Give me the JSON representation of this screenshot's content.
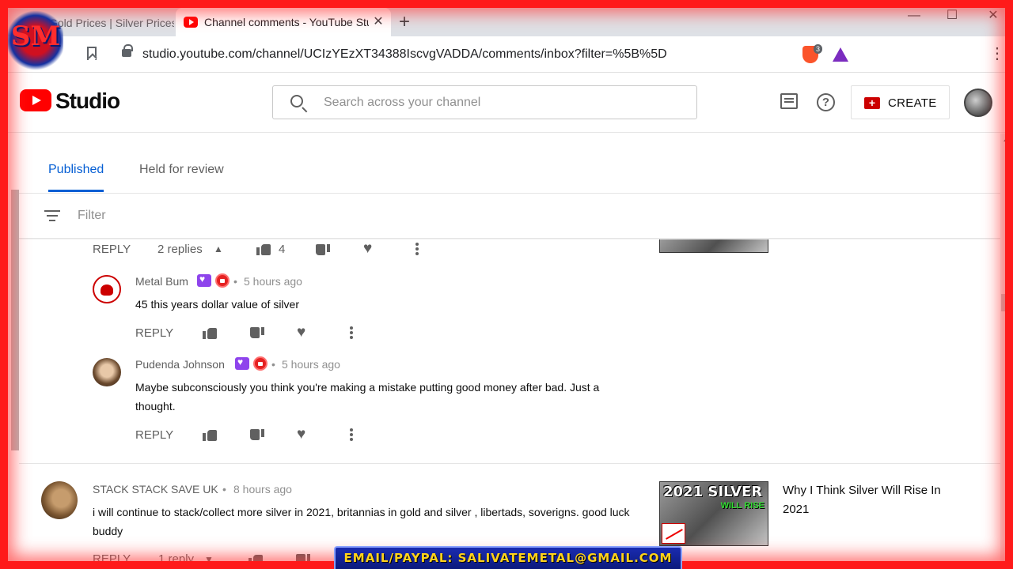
{
  "browser": {
    "inactive_tab": "Gold Prices | Silver Prices | Platinum",
    "active_tab": "Channel comments - YouTube Studio",
    "new_tab": "+",
    "minimize": "—",
    "maximize": "☐",
    "close": "✕",
    "url": "studio.youtube.com/channel/UCIzYEzXT34388IscvgVADDA/comments/inbox?filter=%5B%5D",
    "brave_badge": "3"
  },
  "header": {
    "studio_label": "Studio",
    "search_placeholder": "Search across your channel",
    "create_label": "CREATE",
    "help_glyph": "?"
  },
  "tabs": {
    "published": "Published",
    "held": "Held for review"
  },
  "filter": {
    "label": "Filter"
  },
  "thread1": {
    "reply_label": "REPLY",
    "replies_label": "2 replies",
    "like_count": "4",
    "replies": [
      {
        "author": "Metal Bum",
        "time": "5 hours ago",
        "text": "45 this years dollar value of silver",
        "reply_label": "REPLY"
      },
      {
        "author": "Pudenda Johnson",
        "time": "5 hours ago",
        "text": "Maybe subconsciously you think you're making a mistake putting good money after bad. Just a thought.",
        "reply_label": "REPLY"
      }
    ]
  },
  "thread2": {
    "author": "STACK STACK SAVE UK",
    "time": "8 hours ago",
    "text": "i will continue to stack/collect more silver in 2021, britannias in gold and silver , libertads, soverigns. good luck buddy",
    "reply_label": "REPLY",
    "replies_label": "1 reply",
    "video_title": "Why I Think Silver Will Rise In 2021",
    "thumb_title": "2021 SILVER",
    "thumb_subtitle": "WILL RISE"
  },
  "separator": "•",
  "overlay": {
    "logo_text": "SM",
    "email_banner": "EMAIL/PAYPAL: SALIVATEMETAL@GMAIL.COM"
  },
  "colors": {
    "accent_blue": "#065fd4",
    "frame_red": "#ff1a1a",
    "youtube_red": "#ff0000"
  }
}
